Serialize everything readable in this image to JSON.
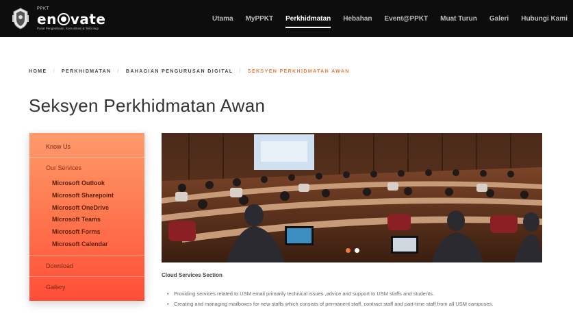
{
  "brand": {
    "prefix": "PPKT",
    "name_left": "en",
    "name_right": "vate",
    "tagline": "Pusat Pengetahuan, Komunikasi & Teknologi"
  },
  "nav": {
    "items": [
      {
        "label": "Utama",
        "active": false
      },
      {
        "label": "MyPPKT",
        "active": false
      },
      {
        "label": "Perkhidmatan",
        "active": true
      },
      {
        "label": "Hebahan",
        "active": false
      },
      {
        "label": "Event@PPKT",
        "active": false
      },
      {
        "label": "Muat Turun",
        "active": false
      },
      {
        "label": "Galeri",
        "active": false
      },
      {
        "label": "Hubungi Kami",
        "active": false
      }
    ]
  },
  "breadcrumb": {
    "items": [
      "HOME",
      "PERKHIDMATAN",
      "BAHAGIAN PENGURUSAN DIGITAL"
    ],
    "separator": "/",
    "current": "SEKSYEN PERKHIDMATAN AWAN"
  },
  "page": {
    "title": "Seksyen Perkhidmatan Awan"
  },
  "sidebar": {
    "know_us": "Know Us",
    "our_services": "Our Services",
    "services": [
      "Microsoft Outlook",
      "Microsoft Sharepoint",
      "Microsoft OneDrive",
      "Microsoft Teams",
      "Microsoft Forms",
      "Microsoft Calendar"
    ],
    "download": "Download",
    "gallery": "Gallery"
  },
  "carousel": {
    "slide_count": 2,
    "active_index": 0,
    "active_color": "#f07b36",
    "inactive_color": "#ffffff"
  },
  "content": {
    "section_title": "Cloud Services Section",
    "bullets": [
      "Providing services related to USM email primarily technical issues ,advice and support to USM staffs and students.",
      "Creating and managing mailboxes for new staffs which consists of permanent staff, contract staff and part-time staff from all USM campuses."
    ]
  },
  "colors": {
    "nav_bg": "#0d0d0d",
    "accent": "#f07b36",
    "sidebar_top": "#ff9a6c",
    "sidebar_bottom": "#ff4d38"
  }
}
